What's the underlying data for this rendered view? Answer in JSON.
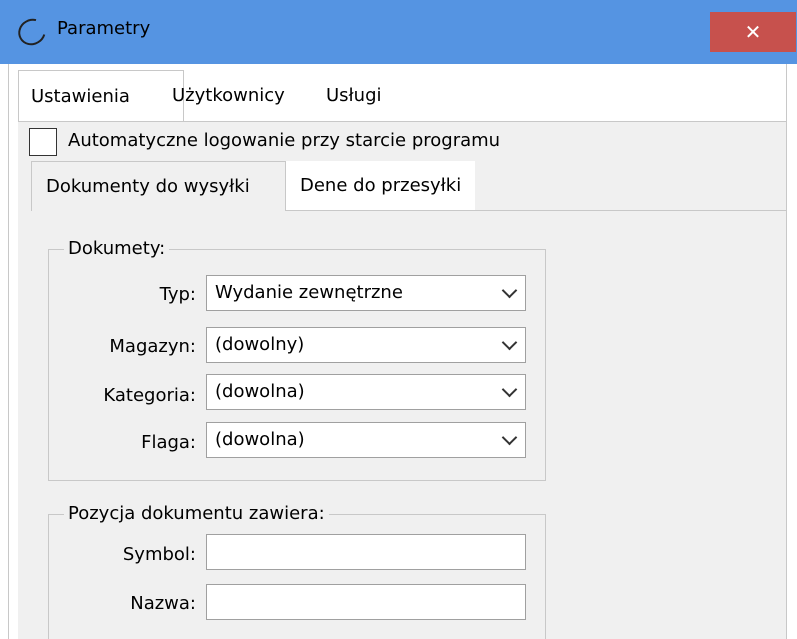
{
  "window": {
    "title": "Parametry",
    "close_glyph": "✕",
    "icon": "app-logo-icon"
  },
  "tabs": [
    "Ustawienia",
    "Użytkownicy",
    "Usługi"
  ],
  "autologin": {
    "label": "Automatyczne logowanie przy starcie programu",
    "checked": false
  },
  "subtabs": [
    "Dokumenty do wysyłki",
    "Dene do przesyłki"
  ],
  "dokumenty": {
    "legend": "Dokumety:",
    "fields": [
      {
        "label": "Typ:",
        "value": "Wydanie zewnętrzne"
      },
      {
        "label": "Magazyn:",
        "value": "(dowolny)"
      },
      {
        "label": "Kategoria:",
        "value": "(dowolna)"
      },
      {
        "label": "Flaga:",
        "value": "(dowolna)"
      }
    ]
  },
  "pozycja": {
    "legend": "Pozycja dokumentu zawiera:",
    "fields": [
      {
        "label": "Symbol:",
        "value": ""
      },
      {
        "label": "Nazwa:",
        "value": ""
      }
    ]
  },
  "colors": {
    "titlebar": "#5594e2",
    "close": "#c7514d",
    "panel": "#f0f0f0"
  }
}
